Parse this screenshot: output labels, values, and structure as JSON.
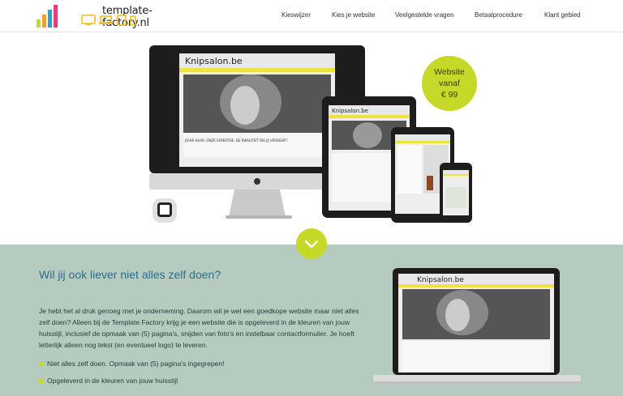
{
  "brand": {
    "name": "template-factory.nl",
    "logo_icon": "bar-chart-logo-icon",
    "device_icons": [
      "desktop-icon",
      "laptop-icon",
      "tablet-icon",
      "phone-icon"
    ]
  },
  "nav": {
    "items": [
      "Kieswijzer",
      "Kies je website",
      "Veelgestelde vragen",
      "Betaalprocedure",
      "Klant gebied"
    ]
  },
  "hero": {
    "badge": {
      "line1": "Website",
      "line2": "vanaf",
      "line3": "€ 99"
    },
    "demo_site": "Knipsalon.be",
    "demo_tagline": "JOUW HAAR, ONZE EXPERTISE. DE KWALITEIT DIE JIJ VERDIENT!",
    "scroll_icon": "chevron-down-icon"
  },
  "section": {
    "title": "Wil jij ook liever niet alles zelf doen?",
    "paragraph": "Je hebt het al druk genoeg met je onderneming. Daarom wil je wel een goedkope website maar niet alles zelf doen? Alleen bij de Template Factory krijg je een website die is opgeleverd in de kleuren van jouw huisstijl, inclusief de opmaak van (5) pagina's, snijden van foto's en instelbaar contactformulier. Je hoeft letterlijk alleen nog tekst (en eventueel logo) te leveren.",
    "bullets": [
      "Niet alles zelf doen. Opmaak van (5) pagina's ingegrepen!",
      "Opgeleverd in de kleuren van jouw huisstijl"
    ]
  },
  "colors": {
    "accent": "#c6d828",
    "title": "#2a6f8a",
    "section_bg": "#b5cbc0",
    "site_yellow": "#f0e040"
  }
}
